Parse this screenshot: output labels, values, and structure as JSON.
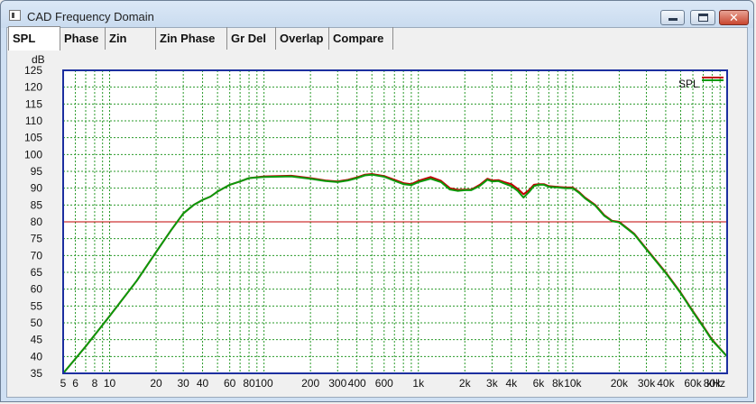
{
  "window": {
    "title": "CAD Frequency Domain",
    "icon": "app-icon",
    "controls": {
      "minimize": "minimize-icon",
      "maximize": "maximize-icon",
      "close": "close-icon"
    }
  },
  "tabs": [
    {
      "label": "SPL",
      "active": true
    },
    {
      "label": "Phase",
      "active": false
    },
    {
      "label": "Zin",
      "active": false
    },
    {
      "label": "Zin Phase",
      "active": false
    },
    {
      "label": "Gr Del",
      "active": false
    },
    {
      "label": "Overlap",
      "active": false
    },
    {
      "label": "Compare",
      "active": false
    }
  ],
  "colors": {
    "plot_border": "#1c2fa0",
    "grid": "#2a9a2a",
    "reference_line": "#c00000",
    "series_green": "#0a9a0a",
    "series_red": "#c00000"
  },
  "chart_data": {
    "type": "line",
    "ylabel": "dB",
    "xlabel": "kHz",
    "x_scale": "log",
    "xlim": [
      5,
      100000
    ],
    "ylim": [
      35,
      125
    ],
    "y_ticks": [
      35,
      40,
      45,
      50,
      55,
      60,
      65,
      70,
      75,
      80,
      85,
      90,
      95,
      100,
      105,
      110,
      115,
      120,
      125
    ],
    "x_tick_labels": [
      {
        "x": 5,
        "label": "5"
      },
      {
        "x": 6,
        "label": "6"
      },
      {
        "x": 8,
        "label": "8"
      },
      {
        "x": 10,
        "label": "10"
      },
      {
        "x": 20,
        "label": "20"
      },
      {
        "x": 30,
        "label": "30"
      },
      {
        "x": 40,
        "label": "40"
      },
      {
        "x": 60,
        "label": "60"
      },
      {
        "x": 80,
        "label": "80"
      },
      {
        "x": 100,
        "label": "100"
      },
      {
        "x": 200,
        "label": "200"
      },
      {
        "x": 300,
        "label": "300"
      },
      {
        "x": 400,
        "label": "400"
      },
      {
        "x": 600,
        "label": "600"
      },
      {
        "x": 1000,
        "label": "1k"
      },
      {
        "x": 2000,
        "label": "2k"
      },
      {
        "x": 3000,
        "label": "3k"
      },
      {
        "x": 4000,
        "label": "4k"
      },
      {
        "x": 6000,
        "label": "6k"
      },
      {
        "x": 8000,
        "label": "8k"
      },
      {
        "x": 10000,
        "label": "10k"
      },
      {
        "x": 20000,
        "label": "20k"
      },
      {
        "x": 30000,
        "label": "30k"
      },
      {
        "x": 40000,
        "label": "40k"
      },
      {
        "x": 60000,
        "label": "60k"
      },
      {
        "x": 80000,
        "label": "80k"
      }
    ],
    "grid": true,
    "legend": {
      "label": "SPL",
      "position": "top-right"
    },
    "reference_line_db": 80,
    "series": [
      {
        "name": "SPL",
        "color": "#c00000",
        "x": [
          5,
          7,
          10,
          15,
          20,
          25,
          30,
          35,
          40,
          45,
          50,
          60,
          70,
          80,
          100,
          150,
          200,
          250,
          300,
          350,
          400,
          450,
          500,
          600,
          700,
          800,
          900,
          1000,
          1200,
          1400,
          1600,
          1800,
          2000,
          2200,
          2500,
          2800,
          3000,
          3300,
          3600,
          4000,
          4400,
          4800,
          5200,
          5600,
          6000,
          6500,
          7000,
          8000,
          9000,
          10000,
          11000,
          12000,
          14000,
          16000,
          18000,
          20000,
          22000,
          25000,
          30000,
          40000,
          50000,
          60000,
          70000,
          80000,
          100000
        ],
        "y": [
          35,
          43,
          52,
          62.5,
          71,
          77.5,
          82.5,
          85,
          86.5,
          87.5,
          89,
          91,
          92,
          93,
          93.5,
          93.7,
          93,
          92.3,
          92,
          92.5,
          93.2,
          94,
          94.2,
          93.6,
          92.5,
          91.5,
          91.2,
          92.2,
          93.3,
          92.2,
          90,
          89.5,
          89.6,
          89.6,
          91,
          92.8,
          92.3,
          92.4,
          91.8,
          91.2,
          89.8,
          88.2,
          89.4,
          91,
          91.2,
          91.2,
          90.6,
          90.4,
          90.2,
          90.2,
          88.8,
          87.2,
          85,
          82,
          80.3,
          80,
          78.5,
          76.5,
          72,
          65,
          59,
          53.5,
          49,
          45,
          40
        ]
      },
      {
        "name": "",
        "color": "#0a9a0a",
        "x": [
          5,
          7,
          10,
          15,
          20,
          25,
          30,
          35,
          40,
          45,
          50,
          60,
          70,
          80,
          100,
          150,
          200,
          250,
          300,
          350,
          400,
          450,
          500,
          600,
          700,
          800,
          900,
          1000,
          1200,
          1400,
          1600,
          1800,
          2000,
          2200,
          2500,
          2800,
          3000,
          3300,
          3600,
          4000,
          4400,
          4800,
          5200,
          5600,
          6000,
          6500,
          7000,
          8000,
          9000,
          10000,
          11000,
          12000,
          14000,
          16000,
          18000,
          20000,
          22000,
          25000,
          30000,
          40000,
          50000,
          60000,
          70000,
          80000,
          100000
        ],
        "y": [
          35,
          43,
          52,
          62.5,
          71,
          77.5,
          82.5,
          85,
          86.5,
          87.5,
          89,
          91,
          92,
          93,
          93.3,
          93.5,
          92.8,
          92.1,
          91.8,
          92.3,
          93,
          93.8,
          94,
          93.4,
          92.2,
          91.2,
          90.9,
          91.8,
          92.8,
          91.8,
          89.6,
          89.2,
          89.4,
          89.4,
          90.7,
          92.5,
          92,
          92.1,
          91.4,
          90.6,
          89.2,
          87.2,
          88.8,
          90.6,
          91,
          91,
          90.4,
          90.2,
          90,
          90,
          88.6,
          87,
          84.8,
          81.8,
          80.2,
          79.8,
          78.3,
          76.3,
          71.8,
          64.8,
          58.8,
          53.3,
          48.8,
          44.8,
          40
        ]
      }
    ]
  }
}
